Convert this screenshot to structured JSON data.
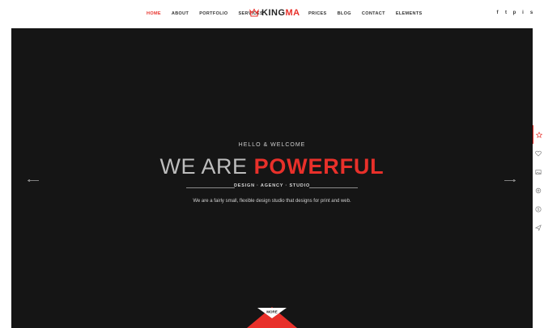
{
  "nav": {
    "left": [
      "HOME",
      "ABOUT",
      "PORTFOLIO",
      "SERVICES"
    ],
    "right": [
      "PRICES",
      "BLOG",
      "CONTACT",
      "ELEMENTS"
    ]
  },
  "logo": {
    "part1": "KING",
    "part2": "MA"
  },
  "social": [
    {
      "icon": "facebook-icon",
      "glyph": "f"
    },
    {
      "icon": "twitter-icon",
      "glyph": "t"
    },
    {
      "icon": "pinterest-icon",
      "glyph": "p"
    },
    {
      "icon": "instagram-icon",
      "glyph": "i"
    },
    {
      "icon": "skype-icon",
      "glyph": "s"
    }
  ],
  "hero": {
    "hello": "HELLO & WELCOME",
    "headline_thin": "WE ARE ",
    "headline_bold": "POWERFUL",
    "tagline": "DESIGN · AGENCY · STUDIO",
    "description": "We are a fairly small, flexible design studio that designs for print and web.",
    "more": "MORE"
  },
  "sidebar": [
    "star-icon",
    "heart-icon",
    "image-icon",
    "gear-icon",
    "dollar-icon",
    "send-icon"
  ],
  "colors": {
    "accent": "#e8302a",
    "hero_bg": "#151515"
  }
}
